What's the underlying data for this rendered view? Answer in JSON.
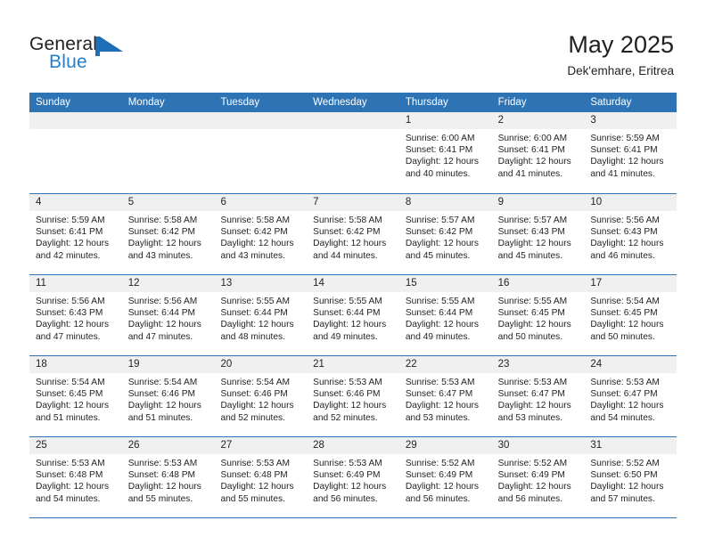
{
  "brand": {
    "name_part1": "General",
    "name_part2": "Blue",
    "flag_icon": "blue-flag-icon",
    "color_dark": "#231f20",
    "color_blue": "#1f7fd0"
  },
  "header": {
    "title": "May 2025",
    "subtitle": "Dek'emhare, Eritrea"
  },
  "theme": {
    "header_blue": "#2e74b5",
    "day_band_gray": "#f0f0f0",
    "text": "#231f20"
  },
  "weekdays": [
    "Sunday",
    "Monday",
    "Tuesday",
    "Wednesday",
    "Thursday",
    "Friday",
    "Saturday"
  ],
  "weeks": [
    [
      {
        "day": "",
        "lines": []
      },
      {
        "day": "",
        "lines": []
      },
      {
        "day": "",
        "lines": []
      },
      {
        "day": "",
        "lines": []
      },
      {
        "day": "1",
        "lines": [
          "Sunrise: 6:00 AM",
          "Sunset: 6:41 PM",
          "Daylight: 12 hours",
          "and 40 minutes."
        ]
      },
      {
        "day": "2",
        "lines": [
          "Sunrise: 6:00 AM",
          "Sunset: 6:41 PM",
          "Daylight: 12 hours",
          "and 41 minutes."
        ]
      },
      {
        "day": "3",
        "lines": [
          "Sunrise: 5:59 AM",
          "Sunset: 6:41 PM",
          "Daylight: 12 hours",
          "and 41 minutes."
        ]
      }
    ],
    [
      {
        "day": "4",
        "lines": [
          "Sunrise: 5:59 AM",
          "Sunset: 6:41 PM",
          "Daylight: 12 hours",
          "and 42 minutes."
        ]
      },
      {
        "day": "5",
        "lines": [
          "Sunrise: 5:58 AM",
          "Sunset: 6:42 PM",
          "Daylight: 12 hours",
          "and 43 minutes."
        ]
      },
      {
        "day": "6",
        "lines": [
          "Sunrise: 5:58 AM",
          "Sunset: 6:42 PM",
          "Daylight: 12 hours",
          "and 43 minutes."
        ]
      },
      {
        "day": "7",
        "lines": [
          "Sunrise: 5:58 AM",
          "Sunset: 6:42 PM",
          "Daylight: 12 hours",
          "and 44 minutes."
        ]
      },
      {
        "day": "8",
        "lines": [
          "Sunrise: 5:57 AM",
          "Sunset: 6:42 PM",
          "Daylight: 12 hours",
          "and 45 minutes."
        ]
      },
      {
        "day": "9",
        "lines": [
          "Sunrise: 5:57 AM",
          "Sunset: 6:43 PM",
          "Daylight: 12 hours",
          "and 45 minutes."
        ]
      },
      {
        "day": "10",
        "lines": [
          "Sunrise: 5:56 AM",
          "Sunset: 6:43 PM",
          "Daylight: 12 hours",
          "and 46 minutes."
        ]
      }
    ],
    [
      {
        "day": "11",
        "lines": [
          "Sunrise: 5:56 AM",
          "Sunset: 6:43 PM",
          "Daylight: 12 hours",
          "and 47 minutes."
        ]
      },
      {
        "day": "12",
        "lines": [
          "Sunrise: 5:56 AM",
          "Sunset: 6:44 PM",
          "Daylight: 12 hours",
          "and 47 minutes."
        ]
      },
      {
        "day": "13",
        "lines": [
          "Sunrise: 5:55 AM",
          "Sunset: 6:44 PM",
          "Daylight: 12 hours",
          "and 48 minutes."
        ]
      },
      {
        "day": "14",
        "lines": [
          "Sunrise: 5:55 AM",
          "Sunset: 6:44 PM",
          "Daylight: 12 hours",
          "and 49 minutes."
        ]
      },
      {
        "day": "15",
        "lines": [
          "Sunrise: 5:55 AM",
          "Sunset: 6:44 PM",
          "Daylight: 12 hours",
          "and 49 minutes."
        ]
      },
      {
        "day": "16",
        "lines": [
          "Sunrise: 5:55 AM",
          "Sunset: 6:45 PM",
          "Daylight: 12 hours",
          "and 50 minutes."
        ]
      },
      {
        "day": "17",
        "lines": [
          "Sunrise: 5:54 AM",
          "Sunset: 6:45 PM",
          "Daylight: 12 hours",
          "and 50 minutes."
        ]
      }
    ],
    [
      {
        "day": "18",
        "lines": [
          "Sunrise: 5:54 AM",
          "Sunset: 6:45 PM",
          "Daylight: 12 hours",
          "and 51 minutes."
        ]
      },
      {
        "day": "19",
        "lines": [
          "Sunrise: 5:54 AM",
          "Sunset: 6:46 PM",
          "Daylight: 12 hours",
          "and 51 minutes."
        ]
      },
      {
        "day": "20",
        "lines": [
          "Sunrise: 5:54 AM",
          "Sunset: 6:46 PM",
          "Daylight: 12 hours",
          "and 52 minutes."
        ]
      },
      {
        "day": "21",
        "lines": [
          "Sunrise: 5:53 AM",
          "Sunset: 6:46 PM",
          "Daylight: 12 hours",
          "and 52 minutes."
        ]
      },
      {
        "day": "22",
        "lines": [
          "Sunrise: 5:53 AM",
          "Sunset: 6:47 PM",
          "Daylight: 12 hours",
          "and 53 minutes."
        ]
      },
      {
        "day": "23",
        "lines": [
          "Sunrise: 5:53 AM",
          "Sunset: 6:47 PM",
          "Daylight: 12 hours",
          "and 53 minutes."
        ]
      },
      {
        "day": "24",
        "lines": [
          "Sunrise: 5:53 AM",
          "Sunset: 6:47 PM",
          "Daylight: 12 hours",
          "and 54 minutes."
        ]
      }
    ],
    [
      {
        "day": "25",
        "lines": [
          "Sunrise: 5:53 AM",
          "Sunset: 6:48 PM",
          "Daylight: 12 hours",
          "and 54 minutes."
        ]
      },
      {
        "day": "26",
        "lines": [
          "Sunrise: 5:53 AM",
          "Sunset: 6:48 PM",
          "Daylight: 12 hours",
          "and 55 minutes."
        ]
      },
      {
        "day": "27",
        "lines": [
          "Sunrise: 5:53 AM",
          "Sunset: 6:48 PM",
          "Daylight: 12 hours",
          "and 55 minutes."
        ]
      },
      {
        "day": "28",
        "lines": [
          "Sunrise: 5:53 AM",
          "Sunset: 6:49 PM",
          "Daylight: 12 hours",
          "and 56 minutes."
        ]
      },
      {
        "day": "29",
        "lines": [
          "Sunrise: 5:52 AM",
          "Sunset: 6:49 PM",
          "Daylight: 12 hours",
          "and 56 minutes."
        ]
      },
      {
        "day": "30",
        "lines": [
          "Sunrise: 5:52 AM",
          "Sunset: 6:49 PM",
          "Daylight: 12 hours",
          "and 56 minutes."
        ]
      },
      {
        "day": "31",
        "lines": [
          "Sunrise: 5:52 AM",
          "Sunset: 6:50 PM",
          "Daylight: 12 hours",
          "and 57 minutes."
        ]
      }
    ]
  ]
}
